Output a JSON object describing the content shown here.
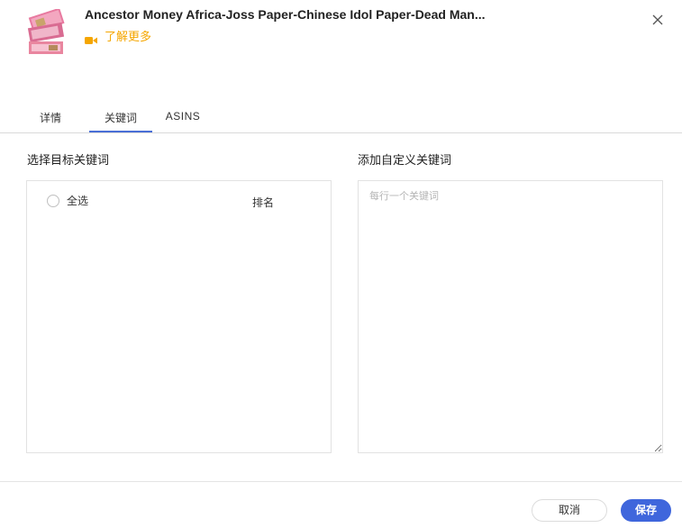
{
  "header": {
    "product_title": "Ancestor Money Africa-Joss Paper-Chinese Idol Paper-Dead Man...",
    "learn_more_label": "了解更多",
    "learn_more_icon": "video-camera-icon",
    "close_icon": "close-icon",
    "thumbnail": "product-thumbnail"
  },
  "tabs": [
    {
      "label": "详情",
      "active": false
    },
    {
      "label": "关键词",
      "active": true
    },
    {
      "label": "ASINS",
      "active": false
    }
  ],
  "left_panel": {
    "title": "选择目标关键词",
    "select_all_label": "全选",
    "rank_header": "排名"
  },
  "right_panel": {
    "title": "添加自定义关键词",
    "placeholder": "每行一个关键词",
    "value": ""
  },
  "footer": {
    "cancel_label": "取消",
    "save_label": "保存"
  },
  "colors": {
    "accent": "#3f66dc",
    "learn_more": "#f5a600",
    "tab_underline": "#4a6fd6"
  }
}
